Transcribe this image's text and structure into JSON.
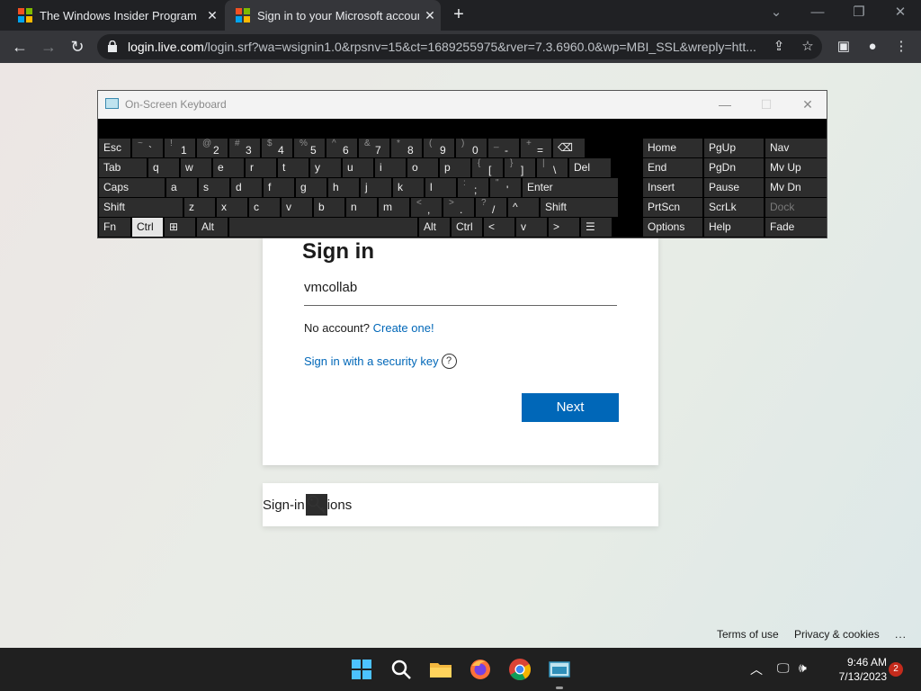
{
  "browser": {
    "tabs": [
      {
        "title": "The Windows Insider Program",
        "active": false
      },
      {
        "title": "Sign in to your Microsoft account",
        "active": true
      }
    ],
    "address": {
      "host": "login.live.com",
      "path": "/login.srf?wa=wsignin1.0&rpsnv=15&ct=1689255975&rver=7.3.6960.0&wp=MBI_SSL&wreply=htt..."
    }
  },
  "signin": {
    "title": "Sign in",
    "email": "vmcollab",
    "no_account": "No account?",
    "create_link": "Create one!",
    "security_key_link": "Sign in with a security key",
    "next_label": "Next"
  },
  "signin_options": {
    "label": "Sign-in options"
  },
  "footer": {
    "terms": "Terms of use",
    "privacy": "Privacy & cookies",
    "more": "..."
  },
  "osk": {
    "title": "On-Screen Keyboard",
    "rows": [
      [
        {
          "m": "Esc"
        },
        {
          "s": "~",
          "b": "`"
        },
        {
          "s": "!",
          "b": "1"
        },
        {
          "s": "@",
          "b": "2"
        },
        {
          "s": "#",
          "b": "3"
        },
        {
          "s": "$",
          "b": "4"
        },
        {
          "s": "%",
          "b": "5"
        },
        {
          "s": "^",
          "b": "6"
        },
        {
          "s": "&",
          "b": "7"
        },
        {
          "s": "*",
          "b": "8"
        },
        {
          "s": "(",
          "b": "9"
        },
        {
          "s": ")",
          "b": "0"
        },
        {
          "s": "_",
          "b": "-"
        },
        {
          "s": "+",
          "b": "="
        },
        {
          "m": "⌫"
        }
      ],
      [
        {
          "m": "Tab"
        },
        {
          "m": "q"
        },
        {
          "m": "w"
        },
        {
          "m": "e"
        },
        {
          "m": "r"
        },
        {
          "m": "t"
        },
        {
          "m": "y"
        },
        {
          "m": "u"
        },
        {
          "m": "i"
        },
        {
          "m": "o"
        },
        {
          "m": "p"
        },
        {
          "s": "{",
          "b": "["
        },
        {
          "s": "}",
          "b": "]"
        },
        {
          "s": "|",
          "b": "\\"
        },
        {
          "m": "Del"
        }
      ],
      [
        {
          "m": "Caps"
        },
        {
          "m": "a"
        },
        {
          "m": "s"
        },
        {
          "m": "d"
        },
        {
          "m": "f"
        },
        {
          "m": "g"
        },
        {
          "m": "h"
        },
        {
          "m": "j"
        },
        {
          "m": "k"
        },
        {
          "m": "l"
        },
        {
          "s": ":",
          "b": ";"
        },
        {
          "s": "\"",
          "b": "'"
        },
        {
          "m": "Enter"
        }
      ],
      [
        {
          "m": "Shift"
        },
        {
          "m": "z"
        },
        {
          "m": "x"
        },
        {
          "m": "c"
        },
        {
          "m": "v"
        },
        {
          "m": "b"
        },
        {
          "m": "n"
        },
        {
          "m": "m"
        },
        {
          "s": "<",
          "b": ","
        },
        {
          "s": ">",
          "b": "."
        },
        {
          "s": "?",
          "b": "/"
        },
        {
          "m": "^"
        },
        {
          "m": "Shift"
        }
      ],
      [
        {
          "m": "Fn"
        },
        {
          "m": "Ctrl"
        },
        {
          "m": "⊞"
        },
        {
          "m": "Alt"
        },
        {
          "m": ""
        },
        {
          "m": "Alt"
        },
        {
          "m": "Ctrl"
        },
        {
          "m": "<"
        },
        {
          "m": "v"
        },
        {
          "m": ">"
        },
        {
          "m": "☰"
        }
      ]
    ],
    "nav": [
      [
        "Home",
        "PgUp",
        "Nav"
      ],
      [
        "End",
        "PgDn",
        "Mv Up"
      ],
      [
        "Insert",
        "Pause",
        "Mv Dn"
      ],
      [
        "PrtScn",
        "ScrLk",
        "Dock"
      ],
      [
        "Options",
        "Help",
        "Fade"
      ]
    ],
    "pressed": "Ctrl"
  },
  "taskbar": {
    "time": "9:46 AM",
    "date": "7/13/2023",
    "notifications": "2",
    "apps": [
      "start-icon",
      "search-icon",
      "file-explorer-icon",
      "firefox-icon",
      "chrome-icon",
      "on-screen-keyboard-icon"
    ]
  }
}
